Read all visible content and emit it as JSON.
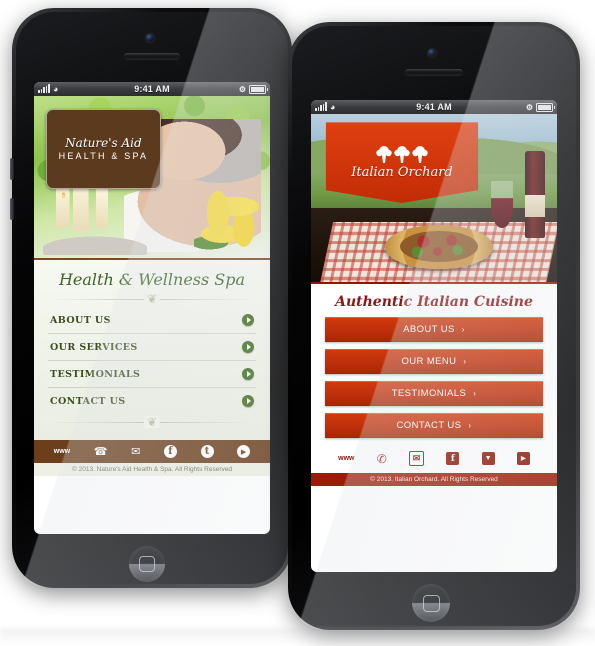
{
  "scene": {
    "description": "Two black iPhones side by side showing mobile website templates"
  },
  "phone_left": {
    "name": "Nature's Aid Health & Spa mobile site",
    "statusbar": {
      "time": "9:41 AM",
      "signal_icon": "signal-bars-icon",
      "wifi_icon": "wifi-icon",
      "bluetooth_icon": "bluetooth-icon",
      "battery_icon": "battery-icon"
    },
    "logo": {
      "line1": "Nature's Aid",
      "line2": "HEALTH & SPA"
    },
    "tagline": "Health & Wellness Spa",
    "nav": [
      {
        "label": "ABOUT US",
        "arrow": "arrow-right-icon"
      },
      {
        "label": "OUR SERVICES",
        "arrow": "arrow-right-icon"
      },
      {
        "label": "TESTIMONIALS",
        "arrow": "arrow-right-icon"
      },
      {
        "label": "CONTACT US",
        "arrow": "arrow-right-icon"
      }
    ],
    "social": [
      {
        "name": "www-icon",
        "glyph": "www"
      },
      {
        "name": "phone-icon",
        "glyph": "☎"
      },
      {
        "name": "email-icon",
        "glyph": "✉"
      },
      {
        "name": "facebook-icon",
        "glyph": "f"
      },
      {
        "name": "twitter-icon",
        "glyph": "t"
      },
      {
        "name": "youtube-icon",
        "glyph": "▶"
      }
    ],
    "copyright": "© 2013. Nature's Aid Health & Spa. All Rights Reserved",
    "colors": {
      "brown": "#6b3f1c",
      "green": "#3f6e1f",
      "cream": "#eef0e4"
    }
  },
  "phone_right": {
    "name": "Italian Orchard mobile site",
    "statusbar": {
      "time": "9:41 AM",
      "signal_icon": "signal-bars-icon",
      "wifi_icon": "wifi-icon",
      "bluetooth_icon": "bluetooth-icon",
      "battery_icon": "battery-icon"
    },
    "logo": {
      "line1": "tree-icons",
      "line2": "Italian Orchard"
    },
    "tagline": "Authentic Italian Cuisine",
    "nav": [
      {
        "label": "ABOUT US",
        "chevron": "›"
      },
      {
        "label": "OUR MENU",
        "chevron": "›"
      },
      {
        "label": "TESTIMONIALS",
        "chevron": "›"
      },
      {
        "label": "CONTACT US",
        "chevron": "›"
      }
    ],
    "social": [
      {
        "name": "www-icon",
        "glyph": "www"
      },
      {
        "name": "phone-icon",
        "glyph": "✆"
      },
      {
        "name": "email-icon",
        "glyph": "✉"
      },
      {
        "name": "facebook-icon",
        "glyph": "f"
      },
      {
        "name": "twitter-icon",
        "glyph": "▼"
      },
      {
        "name": "youtube-icon",
        "glyph": "▶"
      }
    ],
    "copyright": "© 2013. Italian Orchard. All Rights Reserved",
    "colors": {
      "red": "#c0300a",
      "dark_red": "#9c1c08",
      "title_red": "#8c1616"
    }
  }
}
